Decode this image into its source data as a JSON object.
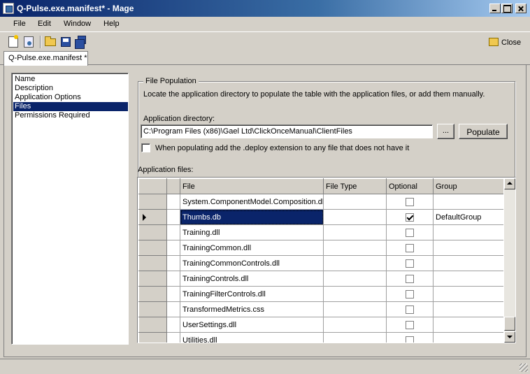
{
  "window": {
    "title": "Q-Pulse.exe.manifest* - Mage"
  },
  "menu": [
    "File",
    "Edit",
    "Window",
    "Help"
  ],
  "toolbar": {
    "close_label": "Close"
  },
  "tabs": [
    "Q-Pulse.exe.manifest *"
  ],
  "nav": {
    "items": [
      "Name",
      "Description",
      "Application Options",
      "Files",
      "Permissions Required"
    ],
    "selected": "Files"
  },
  "file_population": {
    "title": "File Population",
    "description": "Locate the application directory to populate the table with the application files, or add them manually.",
    "directory_label": "Application directory:",
    "directory_value": "C:\\Program Files (x86)\\Gael Ltd\\ClickOnceManual\\ClientFiles",
    "browse_label": "...",
    "populate_label": "Populate",
    "deploy_checkbox_label": "When populating add the .deploy extension to any file that does not have it",
    "deploy_checked": false
  },
  "files": {
    "label": "Application files:",
    "columns": [
      "File",
      "File Type",
      "Optional",
      "Group"
    ],
    "rows": [
      {
        "file": "System.ComponentModel.Composition.dll",
        "type": "",
        "optional": false,
        "group": ""
      },
      {
        "file": "Thumbs.db",
        "type": "",
        "optional": true,
        "group": "DefaultGroup",
        "current": true
      },
      {
        "file": "Training.dll",
        "type": "",
        "optional": false,
        "group": ""
      },
      {
        "file": "TrainingCommon.dll",
        "type": "",
        "optional": false,
        "group": ""
      },
      {
        "file": "TrainingCommonControls.dll",
        "type": "",
        "optional": false,
        "group": ""
      },
      {
        "file": "TrainingControls.dll",
        "type": "",
        "optional": false,
        "group": ""
      },
      {
        "file": "TrainingFilterControls.dll",
        "type": "",
        "optional": false,
        "group": ""
      },
      {
        "file": "TransformedMetrics.css",
        "type": "",
        "optional": false,
        "group": ""
      },
      {
        "file": "UserSettings.dll",
        "type": "",
        "optional": false,
        "group": ""
      },
      {
        "file": "Utilities.dll",
        "type": "",
        "optional": false,
        "group": ""
      }
    ]
  }
}
